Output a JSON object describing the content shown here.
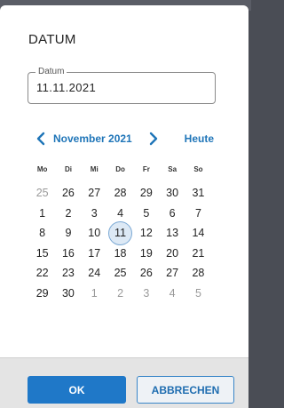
{
  "dialog": {
    "title": "DATUM"
  },
  "date_field": {
    "legend": "Datum",
    "value": "11.11.2021"
  },
  "nav": {
    "month_label": "November 2021",
    "today_label": "Heute"
  },
  "weekdays": [
    "Mo",
    "Di",
    "Mi",
    "Do",
    "Fr",
    "Sa",
    "So"
  ],
  "weeks": [
    [
      {
        "d": "25",
        "m": true
      },
      {
        "d": "26",
        "m": false
      },
      {
        "d": "27",
        "m": false
      },
      {
        "d": "28",
        "m": false
      },
      {
        "d": "29",
        "m": false
      },
      {
        "d": "30",
        "m": false
      },
      {
        "d": "31",
        "m": false
      }
    ],
    [
      {
        "d": "1"
      },
      {
        "d": "2"
      },
      {
        "d": "3"
      },
      {
        "d": "4"
      },
      {
        "d": "5"
      },
      {
        "d": "6"
      },
      {
        "d": "7"
      }
    ],
    [
      {
        "d": "8"
      },
      {
        "d": "9"
      },
      {
        "d": "10"
      },
      {
        "d": "11",
        "sel": true
      },
      {
        "d": "12"
      },
      {
        "d": "13"
      },
      {
        "d": "14"
      }
    ],
    [
      {
        "d": "15"
      },
      {
        "d": "16"
      },
      {
        "d": "17"
      },
      {
        "d": "18"
      },
      {
        "d": "19"
      },
      {
        "d": "20"
      },
      {
        "d": "21"
      }
    ],
    [
      {
        "d": "22"
      },
      {
        "d": "23"
      },
      {
        "d": "24"
      },
      {
        "d": "25"
      },
      {
        "d": "26"
      },
      {
        "d": "27"
      },
      {
        "d": "28"
      }
    ],
    [
      {
        "d": "29"
      },
      {
        "d": "30"
      },
      {
        "d": "1",
        "m": true
      },
      {
        "d": "2",
        "m": true
      },
      {
        "d": "3",
        "m": true
      },
      {
        "d": "4",
        "m": true
      },
      {
        "d": "5",
        "m": true
      }
    ]
  ],
  "footer": {
    "ok_label": "OK",
    "cancel_label": "ABBRECHEN"
  },
  "colors": {
    "accent": "#1f75b8",
    "ok_button": "#1f78c8",
    "selected_day_fill": "#dde9f5"
  },
  "icons": {
    "prev": "chevron-left-icon",
    "next": "chevron-right-icon"
  }
}
